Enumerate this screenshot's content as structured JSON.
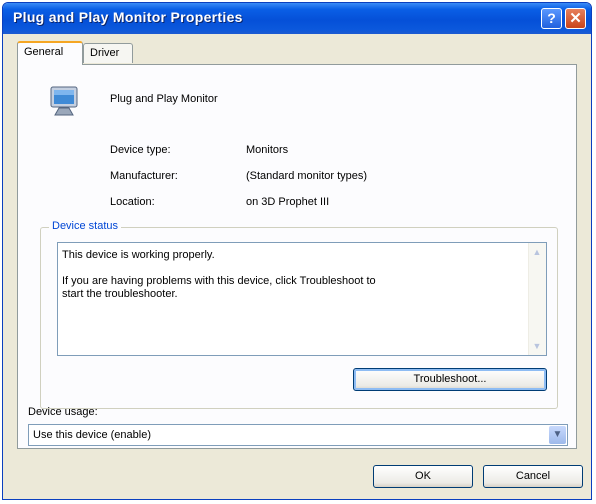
{
  "window": {
    "title": "Plug and Play Monitor Properties",
    "help_glyph": "?",
    "close_glyph": "✕"
  },
  "tabs": [
    {
      "label": "General",
      "active": true
    },
    {
      "label": "Driver",
      "active": false
    }
  ],
  "device": {
    "icon": "monitor-icon",
    "name": "Plug and Play Monitor",
    "properties": [
      {
        "label": "Device type:",
        "value": "Monitors"
      },
      {
        "label": "Manufacturer:",
        "value": "(Standard monitor types)"
      },
      {
        "label": "Location:",
        "value": "on 3D Prophet III"
      }
    ]
  },
  "status": {
    "legend": "Device status",
    "lines": [
      "This device is working properly.",
      "If you are having problems with this device, click Troubleshoot to",
      "start the troubleshooter."
    ],
    "troubleshoot_label": "Troubleshoot..."
  },
  "usage": {
    "label": "Device usage:",
    "selected": "Use this device (enable)"
  },
  "footer": {
    "ok_label": "OK",
    "cancel_label": "Cancel"
  },
  "colors": {
    "title_bar": "#0550d8",
    "legend": "#0046d5",
    "dialog_bg": "#ece9d8",
    "tab_highlight": "#f5a623"
  }
}
